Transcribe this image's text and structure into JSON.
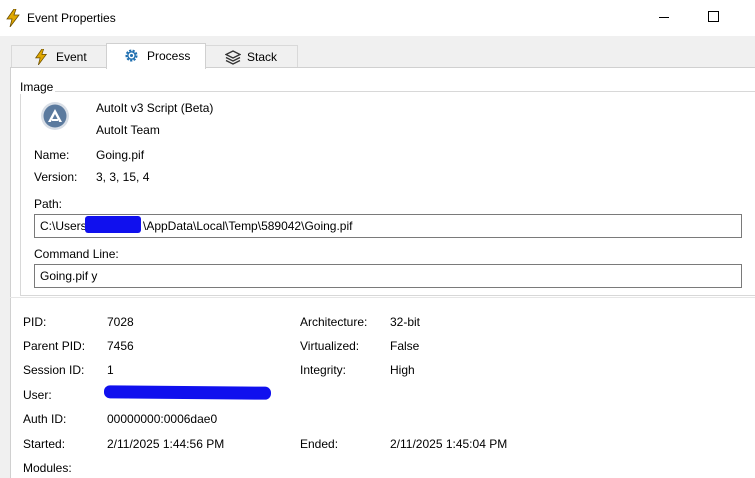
{
  "window": {
    "title": "Event Properties",
    "icon": "lightning-icon",
    "accent": "#d7a400"
  },
  "tabs": [
    {
      "label": "Event",
      "icon": "lightning-icon"
    },
    {
      "label": "Process",
      "icon": "gear-icon",
      "selected": true
    },
    {
      "label": "Stack",
      "icon": "stack-icon"
    }
  ],
  "image": {
    "group_label": "Image",
    "description": "AutoIt v3 Script (Beta)",
    "company": "AutoIt Team",
    "name_label": "Name:",
    "name_value": "Going.pif",
    "version_label": "Version:",
    "version_value": "3, 3, 15, 4",
    "path_label": "Path:",
    "path_prefix": "C:\\Users",
    "path_suffix": "\\AppData\\Local\\Temp\\589042\\Going.pif",
    "cmdline_label": "Command Line:",
    "cmdline_value": "Going.pif  y"
  },
  "process": {
    "pid_label": "PID:",
    "pid_value": "7028",
    "ppid_label": "Parent PID:",
    "ppid_value": "7456",
    "session_label": "Session ID:",
    "session_value": "1",
    "user_label": "User:",
    "authid_label": "Auth ID:",
    "authid_value": "00000000:0006dae0",
    "started_label": "Started:",
    "started_value": "2/11/2025 1:44:56 PM",
    "modules_label": "Modules:",
    "arch_label": "Architecture:",
    "arch_value": "32-bit",
    "virt_label": "Virtualized:",
    "virt_value": "False",
    "integrity_label": "Integrity:",
    "integrity_value": "High",
    "ended_label": "Ended:",
    "ended_value": "2/11/2025 1:45:04 PM"
  },
  "colors": {
    "redaction": "#1010ee",
    "app_icon_bg": "#5b7a9e"
  }
}
